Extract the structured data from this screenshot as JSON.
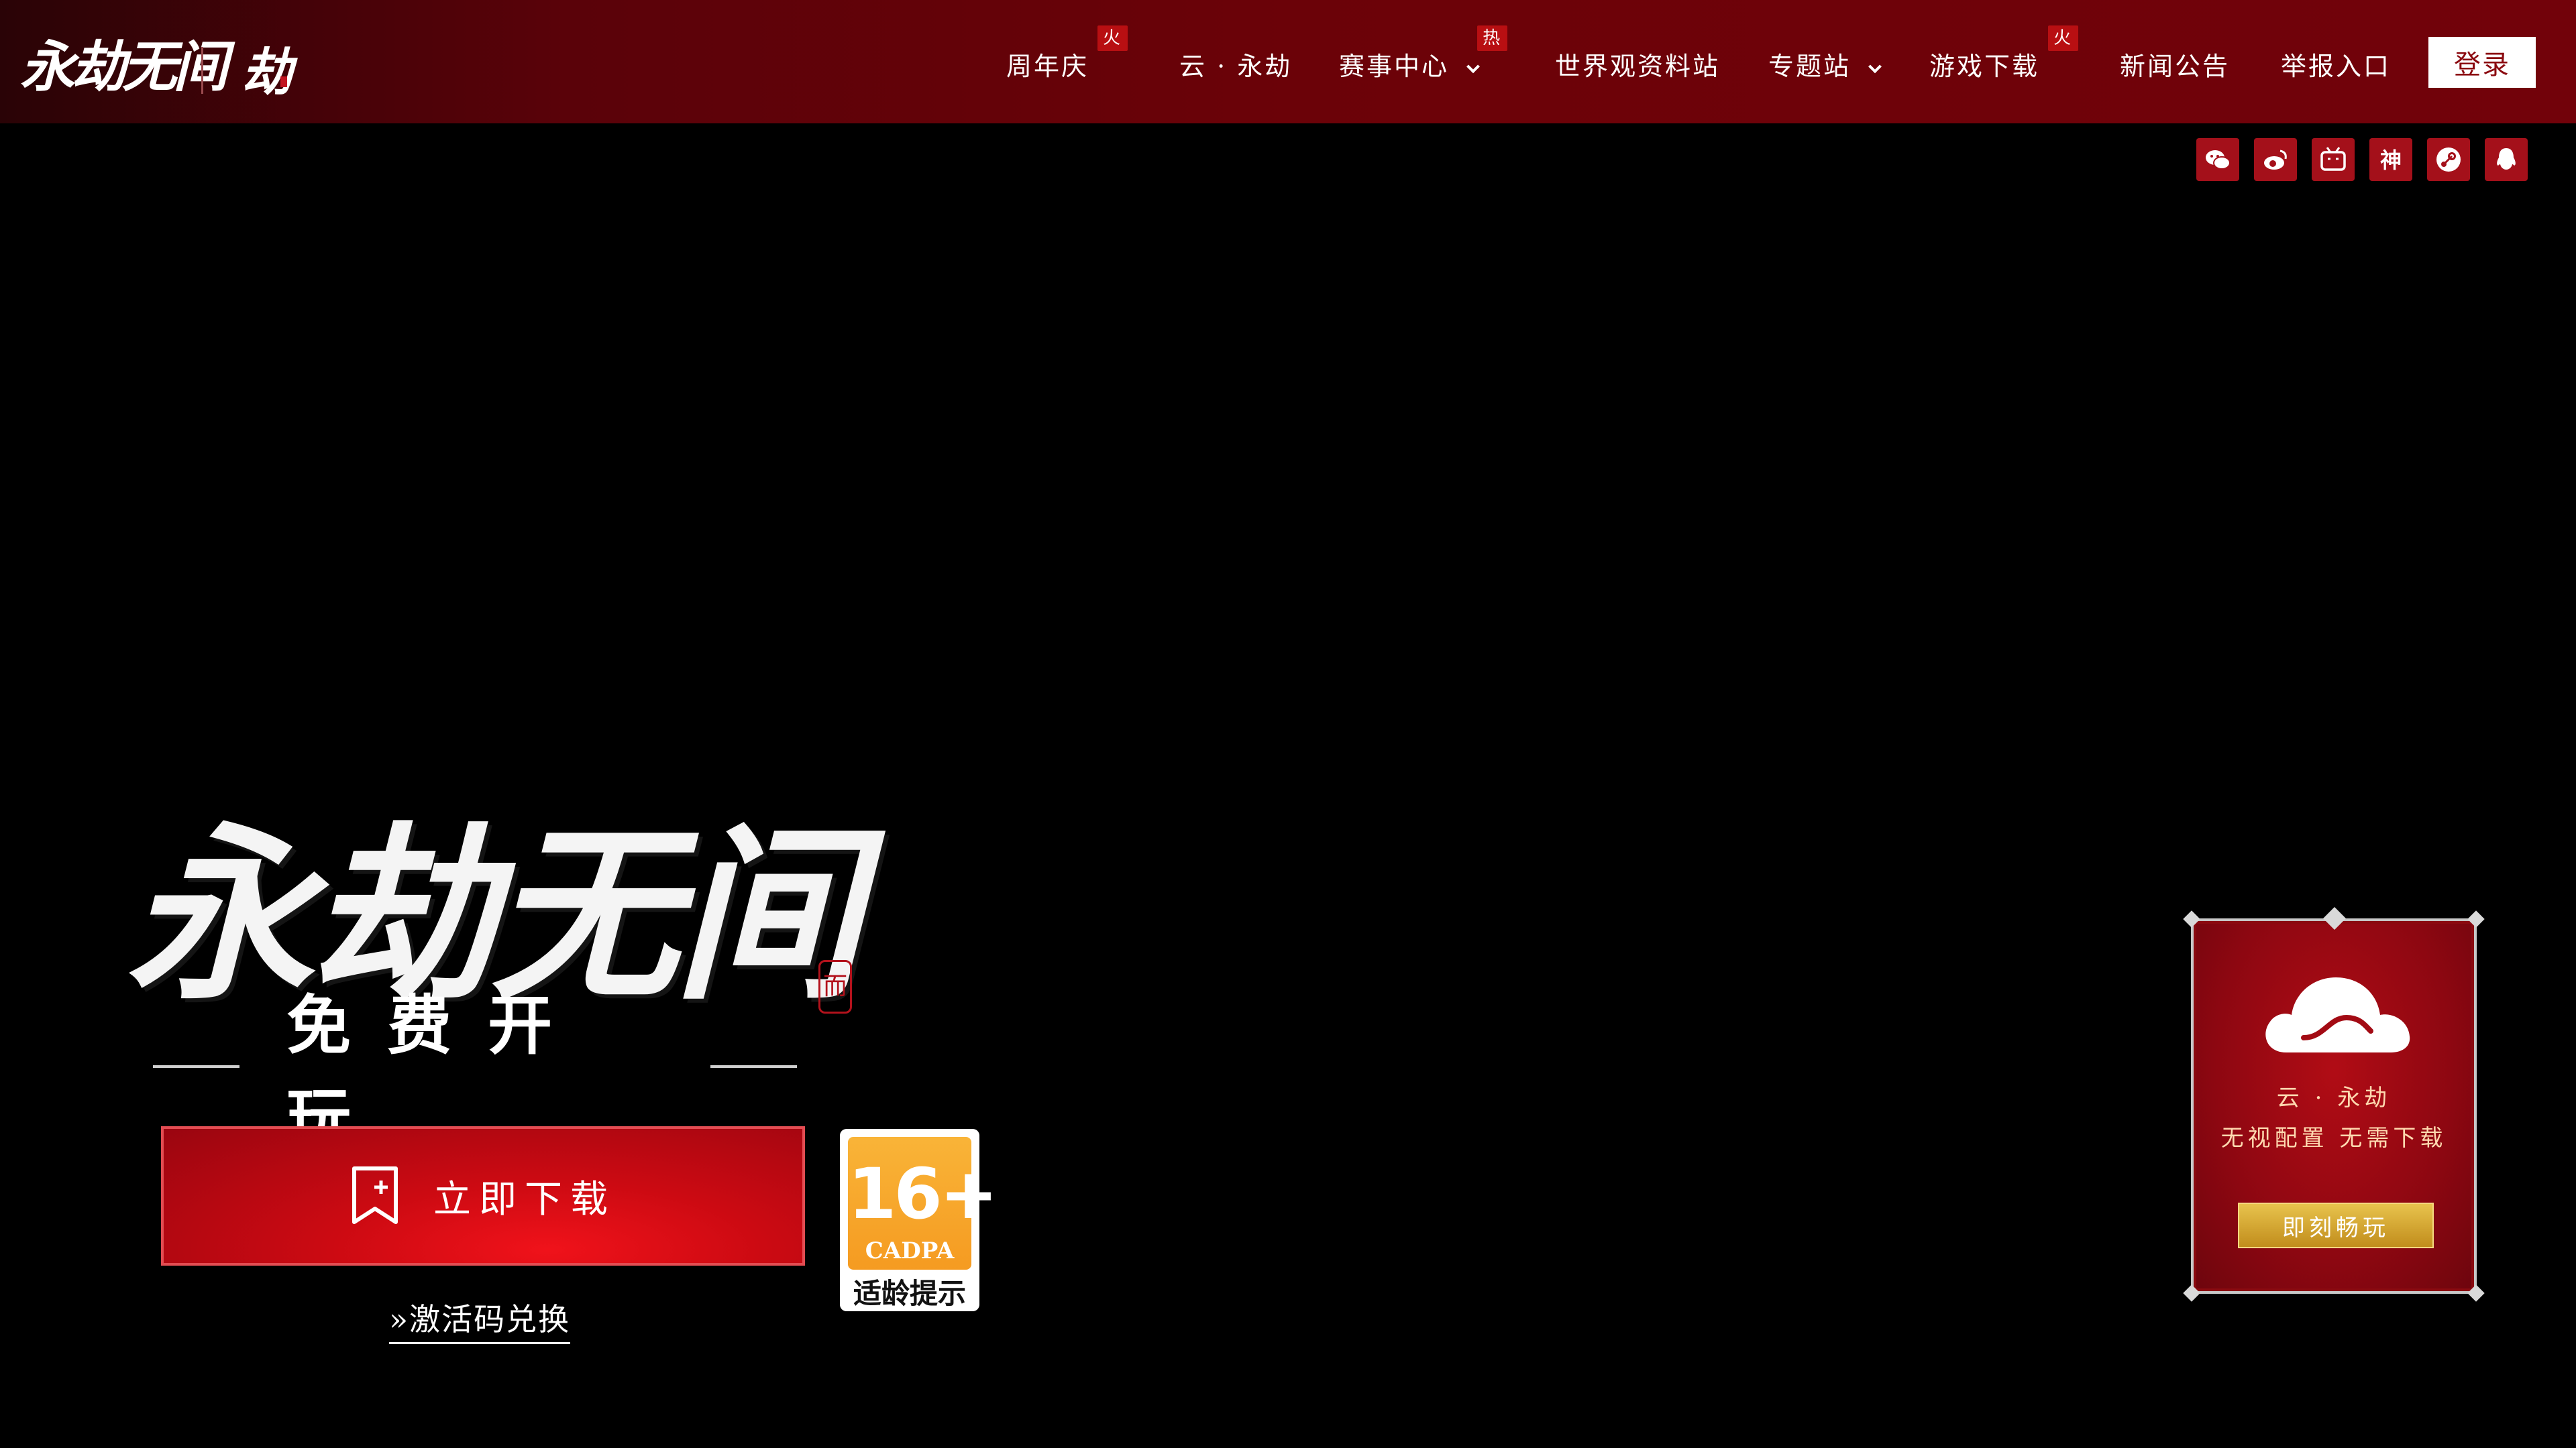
{
  "header": {
    "logo_name": "永劫无间",
    "nav": [
      {
        "label": "周年庆",
        "badge": "火",
        "has_dropdown": false
      },
      {
        "label": "云 · 永劫",
        "badge": "",
        "has_dropdown": false
      },
      {
        "label": "赛事中心",
        "badge": "热",
        "has_dropdown": true
      },
      {
        "label": "世界观资料站",
        "badge": "",
        "has_dropdown": false
      },
      {
        "label": "专题站",
        "badge": "",
        "has_dropdown": true
      },
      {
        "label": "游戏下载",
        "badge": "火",
        "has_dropdown": false
      },
      {
        "label": "新闻公告",
        "badge": "",
        "has_dropdown": false
      },
      {
        "label": "举报入口",
        "badge": "",
        "has_dropdown": false
      }
    ],
    "login_label": "登录"
  },
  "socials": [
    "wechat-icon",
    "weibo-icon",
    "bilibili-icon",
    "shen-icon",
    "steam-icon",
    "qq-icon"
  ],
  "hero": {
    "title": "永劫无间",
    "seal_text": "而",
    "subtitle": "免费开玩",
    "download_label": "立即下载",
    "activate_label": "激活码兑换",
    "activate_prefix": "»"
  },
  "age_badge": {
    "rating": "16+",
    "org": "CADPA",
    "note": "适龄提示"
  },
  "cloud_card": {
    "title": "云 · 永劫",
    "desc": "无视配置 无需下载",
    "play_label": "即刻畅玩"
  },
  "colors": {
    "nav_bg": "#6b0208",
    "accent_red": "#cc0a12",
    "gold": "#e8c34d",
    "age_orange": "#f59b21"
  }
}
